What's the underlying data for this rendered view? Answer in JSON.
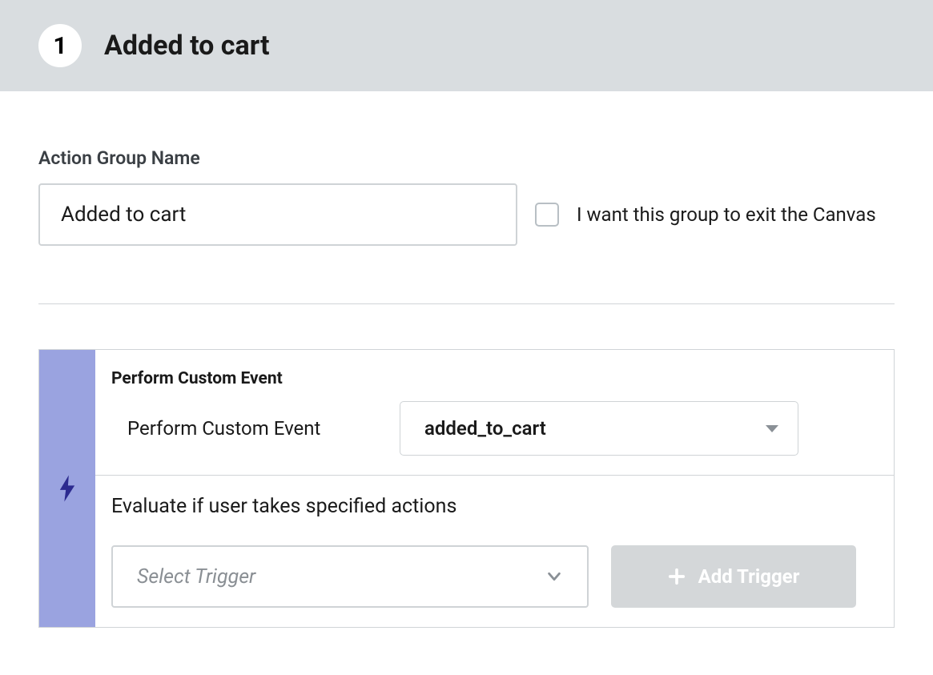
{
  "header": {
    "step_number": "1",
    "title": "Added to cart"
  },
  "form": {
    "name_label": "Action Group Name",
    "name_value": "Added to cart",
    "exit_checkbox_label": "I want this group to exit the Canvas"
  },
  "event": {
    "heading": "Perform Custom Event",
    "row_label": "Perform Custom Event",
    "selected_event": "added_to_cart",
    "evaluate_label": "Evaluate if user takes specified actions",
    "trigger_placeholder": "Select Trigger",
    "add_trigger_label": "Add Trigger"
  }
}
